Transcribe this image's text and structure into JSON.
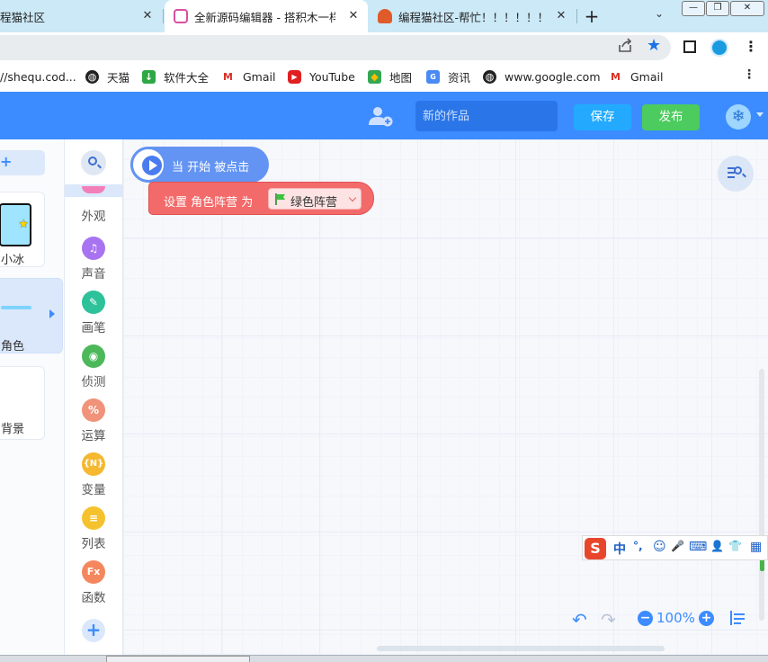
{
  "browser": {
    "tabs": [
      {
        "title": "程猫社区",
        "favicon": "codemao-icon"
      },
      {
        "title": "全新源码编辑器 - 搭积木一样有趣",
        "favicon": "editor-icon"
      },
      {
        "title": "编程猫社区-帮忙！！！！！！",
        "favicon": "codemao-icon"
      }
    ],
    "close_glyph": "✕",
    "new_tab_glyph": "+",
    "tab_menu_glyph": "⌄",
    "window_controls": [
      "—",
      "❐",
      "✕"
    ]
  },
  "bookmarks": [
    {
      "label": "//shequ.cod...",
      "icon": ""
    },
    {
      "label": "天猫",
      "icon": "globe-icon"
    },
    {
      "label": "软件大全",
      "icon": "download-icon"
    },
    {
      "label": "Gmail",
      "icon": "gmail-icon"
    },
    {
      "label": "YouTube",
      "icon": "youtube-icon"
    },
    {
      "label": "地图",
      "icon": "maps-icon"
    },
    {
      "label": "资讯",
      "icon": "news-icon"
    },
    {
      "label": "www.google.com",
      "icon": "globe-icon"
    },
    {
      "label": "Gmail",
      "icon": "gmail-icon"
    }
  ],
  "bookmarks_more": "⋮",
  "header": {
    "title_placeholder": "新的作品",
    "save_label": "保存",
    "publish_label": "发布",
    "avatar_glyph": "❄"
  },
  "sprites": {
    "add_glyph": "+",
    "items": [
      {
        "name": "小冰",
        "active": false
      },
      {
        "name": "角色",
        "active": true
      }
    ],
    "stage_name": "背景"
  },
  "categories": [
    {
      "name": "外观",
      "color": "#f27fb8",
      "glyph": ""
    },
    {
      "name": "声音",
      "color": "#a873f0",
      "glyph": "♫"
    },
    {
      "name": "画笔",
      "color": "#2dc29a",
      "glyph": "✎"
    },
    {
      "name": "侦测",
      "color": "#4cb85a",
      "glyph": "◉"
    },
    {
      "name": "运算",
      "color": "#f0937a",
      "glyph": "%"
    },
    {
      "name": "变量",
      "color": "#f5b82e",
      "glyph": "{N}"
    },
    {
      "name": "列表",
      "color": "#f5c22e",
      "glyph": "≡"
    },
    {
      "name": "函数",
      "color": "#f5875e",
      "glyph": "Fx"
    }
  ],
  "blocks": {
    "hat_text": "当 开始 被点击",
    "set_text": "设置 角色阵营 为",
    "dropdown_value": "绿色阵营",
    "colors": {
      "hat": "#6394f3",
      "set": "#f36a6a"
    }
  },
  "ime": {
    "items": [
      "中",
      "°,",
      "☺",
      "🎤",
      "⌨",
      "👤",
      "👕",
      "▦"
    ]
  },
  "workspace": {
    "undo_glyph": "↶",
    "redo_glyph": "↷",
    "zoom_out_glyph": "−",
    "zoom_in_glyph": "+",
    "zoom_level": "100%"
  },
  "theme": {
    "header_blue": "#3c8cff",
    "save_blue": "#23aaff",
    "publish_green": "#4ccb5e",
    "tabstrip": "#cce9f7"
  }
}
